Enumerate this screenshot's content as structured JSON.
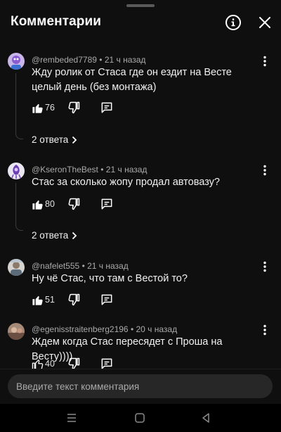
{
  "header": {
    "title": "Комментарии",
    "info_icon": "info-circle-icon",
    "close_icon": "close-icon"
  },
  "comments": [
    {
      "author": "@rembeded7789",
      "time": "21 ч назад",
      "text": "Жду ролик от Стаса где он ездит на Весте целый день (без монтажа)",
      "likes": "76",
      "replies": "2 ответа"
    },
    {
      "author": "@KseronTheBest",
      "time": "21 ч назад",
      "text": "Стас за сколько жопу продал автовазу?",
      "likes": "80",
      "replies": "2 ответа"
    },
    {
      "author": "@nafelet555",
      "time": "21 ч назад",
      "text": "Ну чё Стас, что там с Вестой то?",
      "likes": "51"
    },
    {
      "author": "@egenisstraitenberg2196",
      "time": "20 ч назад",
      "text": "Ждем когда Стас пересядет с Проша на Весту))))",
      "likes": "40"
    }
  ],
  "input": {
    "placeholder": "Введите текст комментария"
  },
  "colors": {
    "background": "#0f0f0f",
    "text": "#f1f1f1",
    "secondary_text": "#aaaaaa",
    "input_bg": "#272727"
  }
}
